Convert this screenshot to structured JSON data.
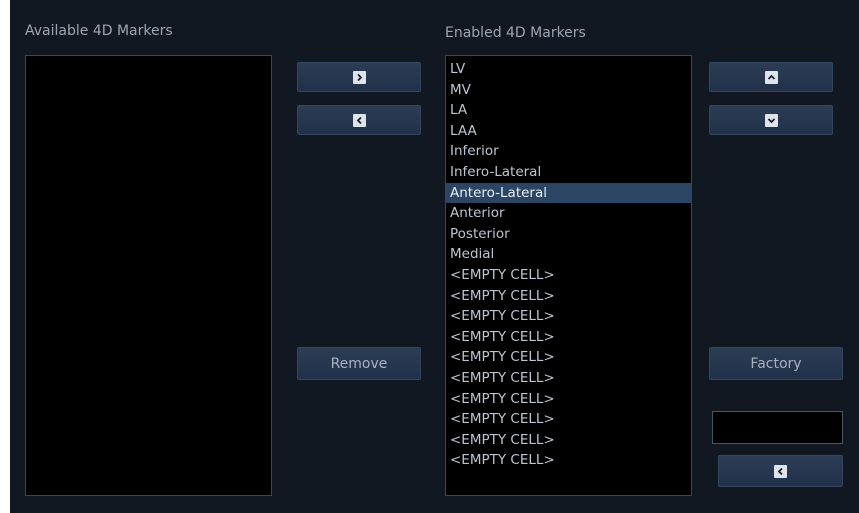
{
  "available_panel": {
    "title": "Available 4D Markers",
    "items": []
  },
  "enabled_panel": {
    "title": "Enabled 4D Markers",
    "items": [
      "LV",
      "MV",
      "LA",
      "LAA",
      "Inferior",
      "Infero-Lateral",
      "Antero-Lateral",
      "Anterior",
      "Posterior",
      "Medial",
      "<EMPTY CELL>",
      "<EMPTY CELL>",
      "<EMPTY CELL>",
      "<EMPTY CELL>",
      "<EMPTY CELL>",
      "<EMPTY CELL>",
      "<EMPTY CELL>",
      "<EMPTY CELL>",
      "<EMPTY CELL>",
      "<EMPTY CELL>"
    ],
    "selected_item": "Antero-Lateral"
  },
  "buttons": {
    "remove_label": "Remove",
    "factory_label": "Factory"
  },
  "icons": {
    "move_right": "chevron-right-icon",
    "move_left": "chevron-left-icon",
    "move_up": "chevron-up-icon",
    "move_down": "chevron-down-icon",
    "apply_back": "chevron-left-icon"
  },
  "factory_name_field": {
    "value": ""
  },
  "colors": {
    "background": "#121822",
    "list_background": "#000000",
    "selection": "#2d4564",
    "button": "#26374e",
    "text": "#bcc6d2"
  }
}
